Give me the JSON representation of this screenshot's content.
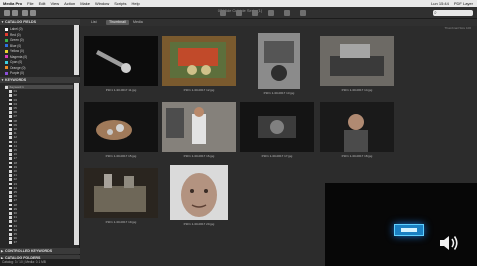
{
  "menubar": {
    "items": [
      "Media Pro",
      "File",
      "Edit",
      "View",
      "Action",
      "Make",
      "Window",
      "Scripts",
      "Help"
    ],
    "status_right": [
      "Lun 15:44",
      "PDF Layer"
    ]
  },
  "toolbar": {
    "window_title": "02 Vide Cubicle Serie (1)"
  },
  "sidebar": {
    "panel1": "CATALOG FIELDS",
    "labels": [
      {
        "name": "Label (0)",
        "color": "#ffffff"
      },
      {
        "name": "Red (0)",
        "color": "#e23a2e"
      },
      {
        "name": "Green (0)",
        "color": "#3bb34a"
      },
      {
        "name": "Blue (0)",
        "color": "#2e6ee0"
      },
      {
        "name": "Yellow (0)",
        "color": "#e9d22e"
      },
      {
        "name": "Magenta (0)",
        "color": "#d83fb9"
      },
      {
        "name": "Cyan (0)",
        "color": "#3ecfe0"
      },
      {
        "name": "Orange (0)",
        "color": "#ee8a26"
      },
      {
        "name": "Purple (0)",
        "color": "#8a4fd8"
      }
    ],
    "panel2": "KEYWORDS",
    "categories": [
      "Keyword 1",
      "01",
      "02",
      "03",
      "04",
      "05",
      "06",
      "07",
      "08",
      "09",
      "10",
      "11",
      "12",
      "13",
      "14",
      "15",
      "16",
      "17",
      "18",
      "19",
      "20",
      "21",
      "22",
      "23",
      "24",
      "25",
      "26",
      "27",
      "28",
      "29",
      "30",
      "31",
      "32",
      "33",
      "34",
      "35",
      "36",
      "37"
    ],
    "panel3": "CONTROLLED KEYWORDS",
    "panel4": "CATALOG FOLDERS",
    "status": "Catalog: 3 / 10  |  Media: 0.1 MB"
  },
  "main": {
    "tabs": [
      "List",
      "Thumbnail",
      "Media"
    ],
    "active_tab": "Thumbnail",
    "column_info": "Thumbnail Size  100  ",
    "thumbnails": [
      {
        "caption": "P1F1 1-30-0017 11.jpg"
      },
      {
        "caption": "P1F1 1-30-0017 12.jpg"
      },
      {
        "caption": "P1F1 1-30-0017 13.jpg"
      },
      {
        "caption": "P1F1 1-30-0017 14.jpg"
      },
      {
        "caption": "P1F1 1-30-0017 15.jpg"
      },
      {
        "caption": "P1F1 1-30-0017 16.jpg"
      },
      {
        "caption": "P1F1 1-30-0017 17.jpg"
      },
      {
        "caption": "P1F1 1-30-0017 18.jpg"
      },
      {
        "caption": "P1F1 1-30-0017 19.jpg"
      },
      {
        "caption": "P1F1 1-30-0017 20.jpg"
      }
    ]
  },
  "overlay": {
    "icon": "speaker-icon"
  }
}
